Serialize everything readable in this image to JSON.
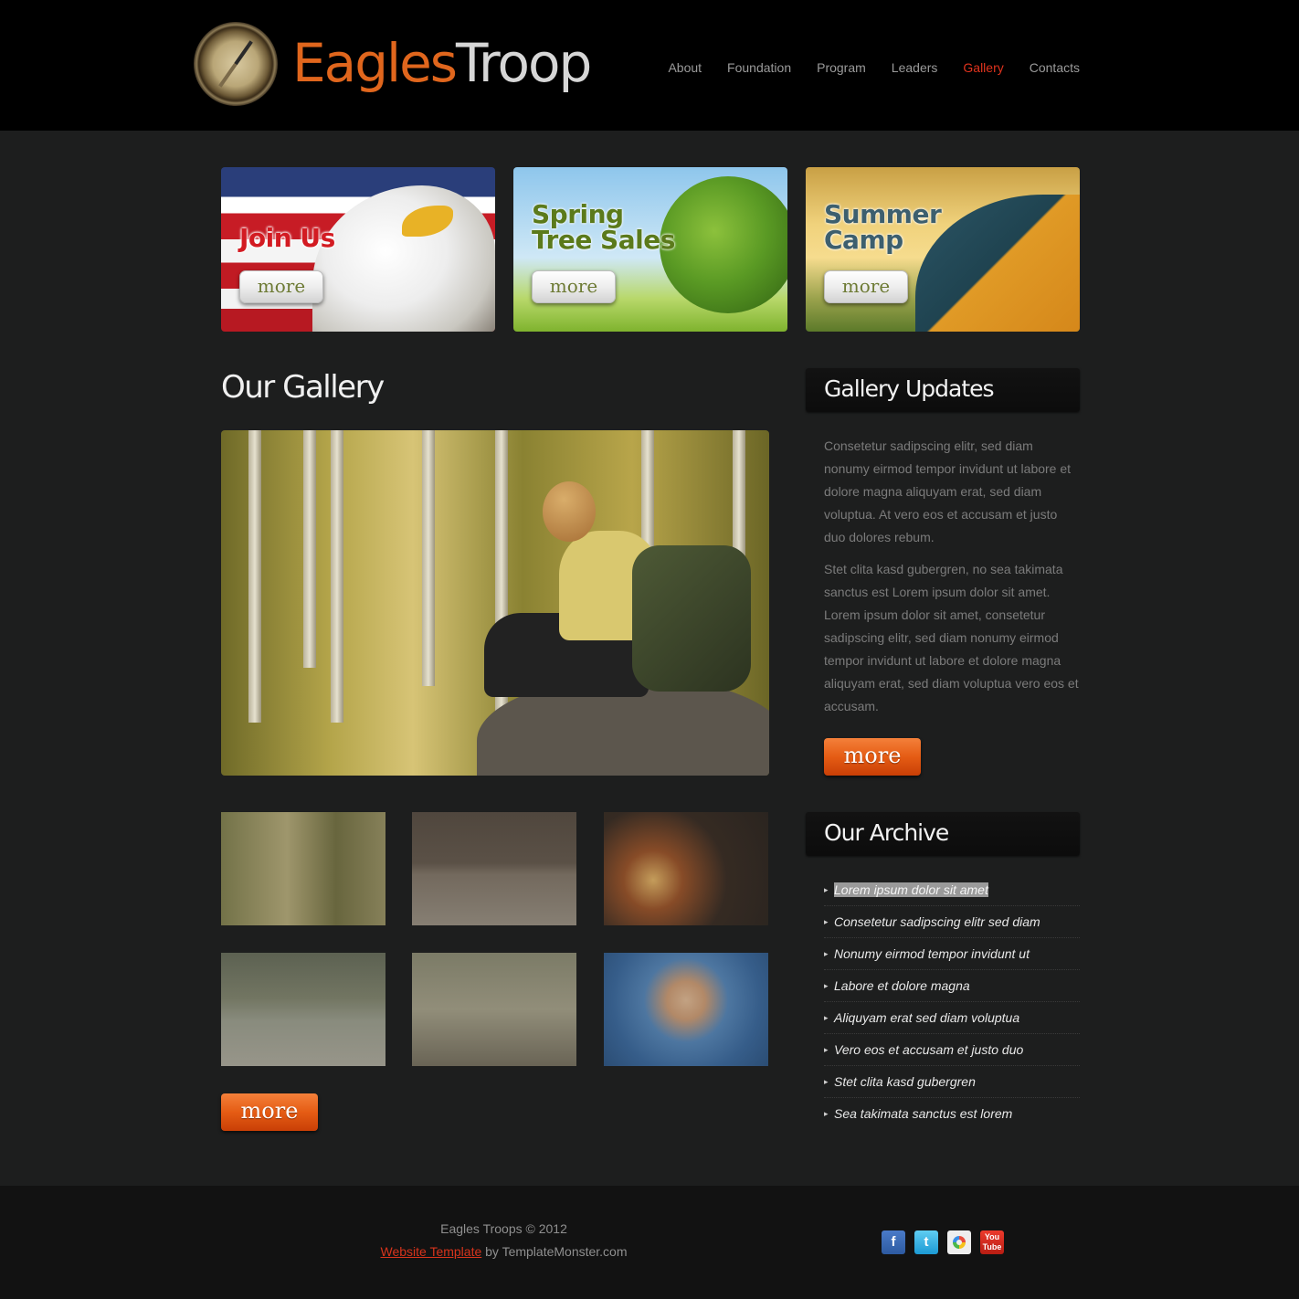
{
  "header": {
    "logo_word1": "Eagles",
    "logo_word2": "Troop",
    "nav": [
      "About",
      "Foundation",
      "Program",
      "Leaders",
      "Gallery",
      "Contacts"
    ],
    "active_nav": "Gallery"
  },
  "banners": [
    {
      "title_line1": "Join Us",
      "title_line2": "",
      "button": "more"
    },
    {
      "title_line1": "Spring",
      "title_line2": "Tree Sales",
      "button": "more"
    },
    {
      "title_line1": "Summer",
      "title_line2": "Camp",
      "button": "more"
    }
  ],
  "gallery": {
    "heading": "Our Gallery",
    "more_button": "more"
  },
  "updates": {
    "heading": "Gallery Updates",
    "paragraph1": "Consetetur sadipscing elitr, sed diam nonumy eirmod tempor invidunt ut labore et dolore magna aliquyam erat, sed diam voluptua. At vero eos et accusam et justo duo dolores rebum.",
    "paragraph2": "Stet clita kasd gubergren, no sea takimata sanctus est Lorem ipsum dolor sit amet. Lorem ipsum dolor sit amet, consetetur sadipscing elitr, sed diam nonumy eirmod tempor invidunt ut labore et dolore magna aliquyam erat, sed diam voluptua vero eos et accusam.",
    "more_button": "more"
  },
  "archive": {
    "heading": "Our Archive",
    "bullet": "▸",
    "items": [
      "Lorem ipsum dolor sit amet",
      "Consetetur sadipscing elitr sed diam",
      "Nonumy eirmod tempor invidunt ut",
      "Labore et dolore magna",
      "Aliquyam erat sed diam voluptua",
      "Vero eos et accusam et justo duo",
      "Stet clita kasd gubergren",
      "Sea takimata sanctus est lorem"
    ]
  },
  "footer": {
    "copyright": "Eagles Troops © 2012",
    "link_text": "Website Template",
    "by_text": " by TemplateMonster.com",
    "social": [
      {
        "icon": "facebook-icon",
        "glyph": "f"
      },
      {
        "icon": "twitter-icon",
        "glyph": "t"
      },
      {
        "icon": "picasa-icon",
        "glyph": ""
      },
      {
        "icon": "youtube-icon",
        "glyph": "You Tube"
      }
    ]
  },
  "colors": {
    "accent_orange": "#e55c14",
    "nav_active": "#e0331d",
    "background": "#1d1e1e"
  }
}
